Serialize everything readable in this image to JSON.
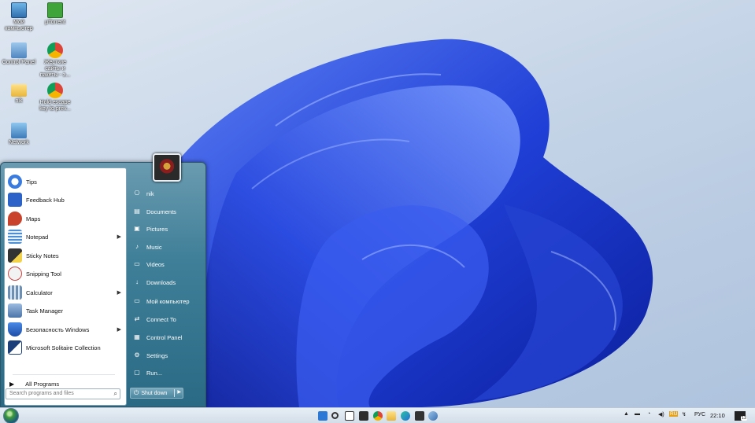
{
  "desktop": {
    "icons": [
      {
        "label": "Мой компьютер",
        "icon": "computer-icon"
      },
      {
        "label": "µTorrent",
        "icon": "utorrent-icon"
      },
      {
        "label": "Control Panel",
        "icon": "control-panel-icon"
      },
      {
        "label": "Жёсткие сайты и пакеты - э...",
        "icon": "chrome-shortcut-icon"
      },
      {
        "label": "nik",
        "icon": "folder-icon"
      },
      {
        "label": "Hold escape key to prev...",
        "icon": "chrome-shortcut-icon"
      },
      {
        "label": "Network",
        "icon": "network-icon"
      }
    ]
  },
  "start_menu": {
    "programs": [
      {
        "label": "Tips",
        "icon": "tips-icon",
        "has_submenu": false
      },
      {
        "label": "Feedback Hub",
        "icon": "feedback-hub-icon",
        "has_submenu": false
      },
      {
        "label": "Maps",
        "icon": "maps-icon",
        "has_submenu": false
      },
      {
        "label": "Notepad",
        "icon": "notepad-icon",
        "has_submenu": true
      },
      {
        "label": "Sticky Notes",
        "icon": "sticky-notes-icon",
        "has_submenu": false
      },
      {
        "label": "Snipping Tool",
        "icon": "snipping-tool-icon",
        "has_submenu": false
      },
      {
        "label": "Calculator",
        "icon": "calculator-icon",
        "has_submenu": true
      },
      {
        "label": "Task Manager",
        "icon": "task-manager-icon",
        "has_submenu": false
      },
      {
        "label": "Безопасность Windows",
        "icon": "windows-security-icon",
        "has_submenu": true
      },
      {
        "label": "Microsoft Solitaire Collection",
        "icon": "solitaire-icon",
        "has_submenu": false
      }
    ],
    "all_programs": "All Programs",
    "search_placeholder": "Search programs and files",
    "places": [
      {
        "label": "nik",
        "icon": "user-icon"
      },
      {
        "label": "Documents",
        "icon": "documents-icon"
      },
      {
        "label": "Pictures",
        "icon": "pictures-icon"
      },
      {
        "label": "Music",
        "icon": "music-icon"
      },
      {
        "label": "Videos",
        "icon": "videos-icon"
      },
      {
        "label": "Downloads",
        "icon": "downloads-icon"
      },
      {
        "label": "Мой компьютер",
        "icon": "computer-icon"
      },
      {
        "label": "Connect To",
        "icon": "connect-to-icon"
      },
      {
        "label": "Control Panel",
        "icon": "control-panel-icon"
      },
      {
        "label": "Settings",
        "icon": "settings-icon"
      },
      {
        "label": "Run...",
        "icon": "run-icon"
      }
    ],
    "shutdown": "Shut down"
  },
  "taskbar": {
    "lang_badge": "RU",
    "lang": "РУС",
    "time": "22:10",
    "notification_count": "13"
  }
}
